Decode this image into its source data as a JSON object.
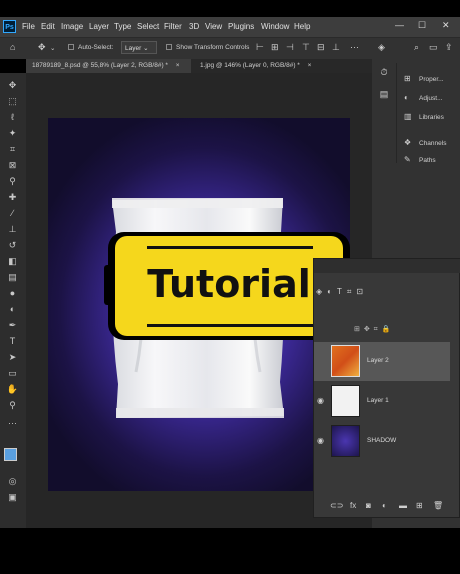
{
  "app": {
    "logo": "Ps"
  },
  "menu": {
    "items": [
      "File",
      "Edit",
      "Image",
      "Layer",
      "Type",
      "Select",
      "Filter",
      "3D",
      "View",
      "Plugins",
      "Window",
      "Help"
    ],
    "window_controls": {
      "minimize": "—",
      "maximize": "☐",
      "close": "✕"
    }
  },
  "options": {
    "auto_select_label": "Auto-Select:",
    "auto_select_value": "Layer",
    "show_transform_label": "Show Transform Controls"
  },
  "tabs": [
    {
      "label": "18789189_8.psd @ 55,8% (Layer 2, RGB/8#) *",
      "close": "×"
    },
    {
      "label": "1.jpg @ 146% (Layer 0, RGB/8#) *",
      "close": "×"
    }
  ],
  "right_panel": {
    "properties": "Proper...",
    "adjustments": "Adjust...",
    "libraries": "Libraries",
    "channels": "Channels",
    "paths": "Paths"
  },
  "overlay": {
    "text": "Tutorial"
  },
  "layers": [
    {
      "name": "Layer 2",
      "visible": false,
      "selected": true
    },
    {
      "name": "Layer 1",
      "visible": true,
      "selected": false
    },
    {
      "name": "SHADOW",
      "visible": true,
      "selected": false
    }
  ],
  "colors": {
    "canvas_bg": "#3d2a9a",
    "banner": "#f5d71c",
    "foreground_swatch": "#5aa0e0",
    "background_swatch": "#ffffff"
  }
}
